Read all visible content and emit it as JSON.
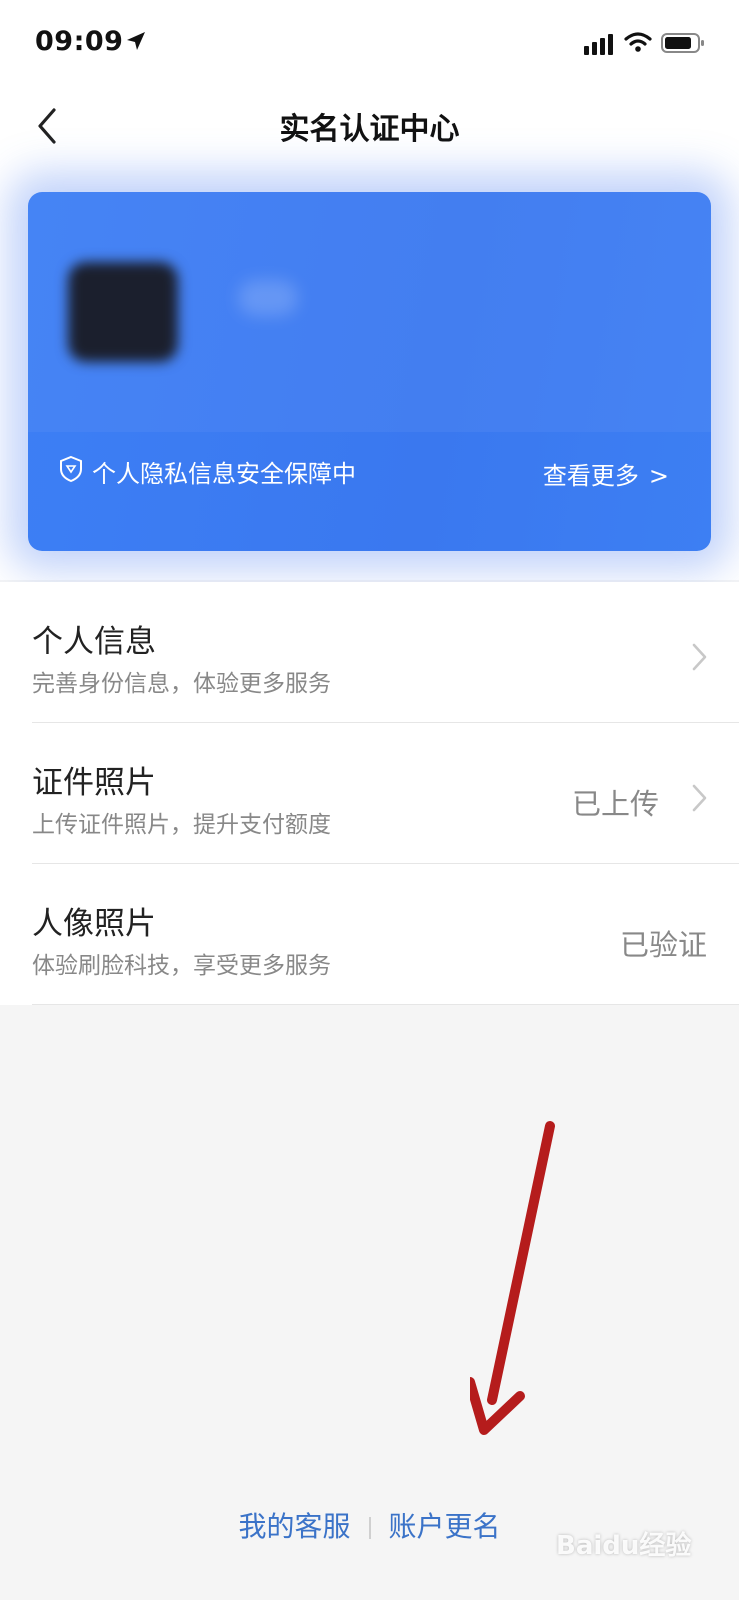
{
  "status_bar": {
    "time": "09:09",
    "location_icon": "location-arrow-icon",
    "signal_icon": "signal-icon",
    "wifi_icon": "wifi-icon",
    "battery_icon": "battery-icon"
  },
  "nav": {
    "title": "实名认证中心",
    "back_icon": "chevron-left-icon"
  },
  "card": {
    "privacy_text": "个人隐私信息安全保障中",
    "privacy_icon": "shield-icon",
    "more_label": "查看更多",
    "more_arrow": ">",
    "accent_color": "#3a78ef"
  },
  "items": [
    {
      "title": "个人信息",
      "subtitle": "完善身份信息，体验更多服务",
      "value": ""
    },
    {
      "title": "证件照片",
      "subtitle": "上传证件照片，提升支付额度",
      "value": "已上传"
    },
    {
      "title": "人像照片",
      "subtitle": "体验刷脸科技，享受更多服务",
      "value": "已验证"
    }
  ],
  "footer": {
    "customer_service": "我的客服",
    "rename_account": "账户更名",
    "link_color": "#3b73c8"
  },
  "watermark": "Baidu经验",
  "annotation": {
    "arrow_color": "#b51c1c",
    "arrow_icon": "red-arrow-icon"
  }
}
